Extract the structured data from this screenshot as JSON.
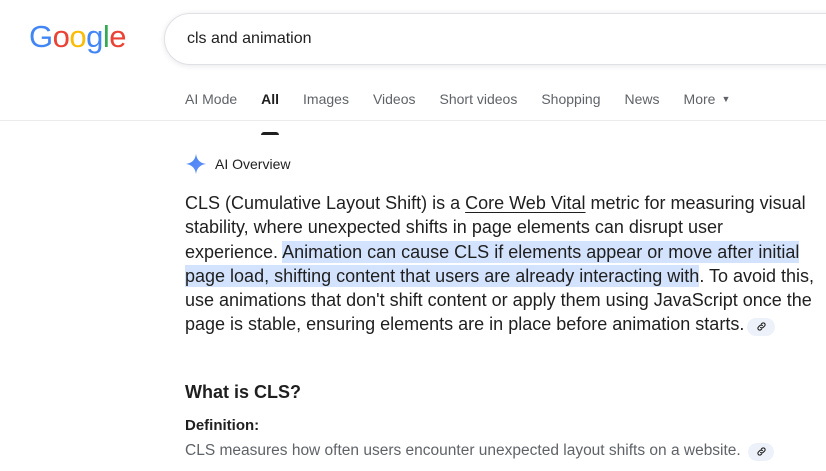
{
  "logo": {
    "letters": [
      "G",
      "o",
      "o",
      "g",
      "l",
      "e"
    ],
    "colors": [
      "#4285F4",
      "#EA4335",
      "#FBBC05",
      "#4285F4",
      "#34A853",
      "#EA4335"
    ]
  },
  "search": {
    "query": "cls and animation"
  },
  "tabs": [
    {
      "label": "AI Mode"
    },
    {
      "label": "All"
    },
    {
      "label": "Images"
    },
    {
      "label": "Videos"
    },
    {
      "label": "Short videos"
    },
    {
      "label": "Shopping"
    },
    {
      "label": "News"
    },
    {
      "label": "More"
    }
  ],
  "ai_overview": {
    "label": "AI Overview",
    "icon": "sparkle-icon",
    "paragraph": {
      "part1": "CLS (Cumulative Layout Shift) is a ",
      "link": "Core Web Vital",
      "part2": " metric for measuring visual stability, where unexpected shifts in page elements can disrupt user experience. ",
      "highlight": "Animation can cause CLS if elements appear or move after initial page load, shifting content that users are already interacting with",
      "part3": ". To avoid this, use animations that don't shift content or apply them using JavaScript once the page is stable, ensuring elements are in place before animation starts."
    },
    "section_title": "What is CLS?",
    "definition_label": "Definition:",
    "definition_text": "CLS measures how often users encounter unexpected layout shifts on a website."
  },
  "colors": {
    "highlight": "#d3e3fd",
    "chip": "#edf2fa",
    "accent_blue": "#4285F4"
  }
}
